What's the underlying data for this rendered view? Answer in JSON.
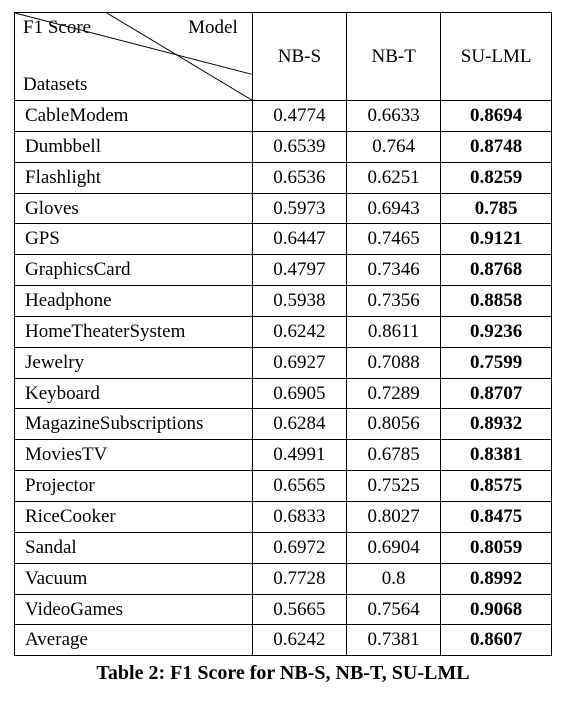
{
  "chart_data": {
    "type": "table",
    "title": "Table 2: F1 Score for NB-S, NB-T, SU-LML",
    "corner": {
      "metric": "F1 Score",
      "column_axis": "Model",
      "row_axis": "Datasets"
    },
    "columns": [
      "NB-S",
      "NB-T",
      "SU-LML"
    ],
    "bold_columns": [
      false,
      false,
      true
    ],
    "rows": [
      {
        "dataset": "CableModem",
        "values": [
          "0.4774",
          "0.6633",
          "0.8694"
        ]
      },
      {
        "dataset": "Dumbbell",
        "values": [
          "0.6539",
          "0.764",
          "0.8748"
        ]
      },
      {
        "dataset": "Flashlight",
        "values": [
          "0.6536",
          "0.6251",
          "0.8259"
        ]
      },
      {
        "dataset": "Gloves",
        "values": [
          "0.5973",
          "0.6943",
          "0.785"
        ]
      },
      {
        "dataset": "GPS",
        "values": [
          "0.6447",
          "0.7465",
          "0.9121"
        ]
      },
      {
        "dataset": "GraphicsCard",
        "values": [
          "0.4797",
          "0.7346",
          "0.8768"
        ]
      },
      {
        "dataset": "Headphone",
        "values": [
          "0.5938",
          "0.7356",
          "0.8858"
        ]
      },
      {
        "dataset": "HomeTheaterSystem",
        "values": [
          "0.6242",
          "0.8611",
          "0.9236"
        ]
      },
      {
        "dataset": "Jewelry",
        "values": [
          "0.6927",
          "0.7088",
          "0.7599"
        ]
      },
      {
        "dataset": "Keyboard",
        "values": [
          "0.6905",
          "0.7289",
          "0.8707"
        ]
      },
      {
        "dataset": "MagazineSubscriptions",
        "values": [
          "0.6284",
          "0.8056",
          "0.8932"
        ]
      },
      {
        "dataset": "MoviesTV",
        "values": [
          "0.4991",
          "0.6785",
          "0.8381"
        ]
      },
      {
        "dataset": "Projector",
        "values": [
          "0.6565",
          "0.7525",
          "0.8575"
        ]
      },
      {
        "dataset": "RiceCooker",
        "values": [
          "0.6833",
          "0.8027",
          "0.8475"
        ]
      },
      {
        "dataset": "Sandal",
        "values": [
          "0.6972",
          "0.6904",
          "0.8059"
        ]
      },
      {
        "dataset": "Vacuum",
        "values": [
          "0.7728",
          "0.8",
          "0.8992"
        ]
      },
      {
        "dataset": "VideoGames",
        "values": [
          "0.5665",
          "0.7564",
          "0.9068"
        ]
      },
      {
        "dataset": "Average",
        "values": [
          "0.6242",
          "0.7381",
          "0.8607"
        ]
      }
    ]
  }
}
